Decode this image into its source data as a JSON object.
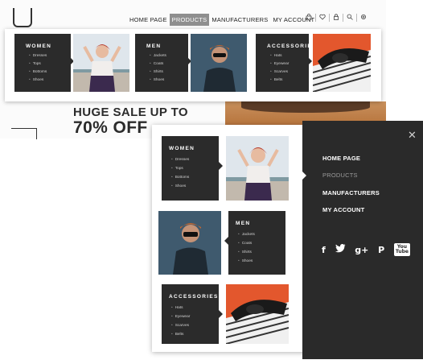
{
  "nav": {
    "items": [
      {
        "label": "HOME PAGE"
      },
      {
        "label": "PRODUCTS"
      },
      {
        "label": "MANUFACTURERS"
      },
      {
        "label": "MY ACCOUNT"
      }
    ],
    "active_index": 1
  },
  "top_icons": [
    "bag-icon",
    "heart-icon",
    "lock-icon",
    "search-icon",
    "gear-icon"
  ],
  "categories": [
    {
      "title": "WOMEN",
      "items": [
        "Dresses",
        "Tops",
        "Bottoms",
        "Shoes"
      ]
    },
    {
      "title": "MEN",
      "items": [
        "Jackets",
        "Coats",
        "Shirts",
        "Shoes"
      ]
    },
    {
      "title": "ACCESSORIES",
      "items": [
        "Hats",
        "Eyewear",
        "Scarves",
        "Belts"
      ]
    }
  ],
  "hero": {
    "line1": "HUGE SALE UP TO",
    "line2": "70% OFF"
  },
  "side_menu": {
    "items": [
      {
        "label": "HOME PAGE"
      },
      {
        "label": "PRODUCTS"
      },
      {
        "label": "MANUFACTURERS"
      },
      {
        "label": "MY ACCOUNT"
      }
    ],
    "social": [
      {
        "name": "facebook-icon",
        "glyph": "f"
      },
      {
        "name": "twitter-icon",
        "glyph": "🐦"
      },
      {
        "name": "google-plus-icon",
        "glyph": "g+"
      },
      {
        "name": "pinterest-icon",
        "glyph": "P"
      },
      {
        "name": "youtube-icon",
        "glyph": "You Tube"
      }
    ]
  },
  "colors": {
    "dark": "#2b2b2b",
    "active_nav": "#8f8f8f"
  }
}
